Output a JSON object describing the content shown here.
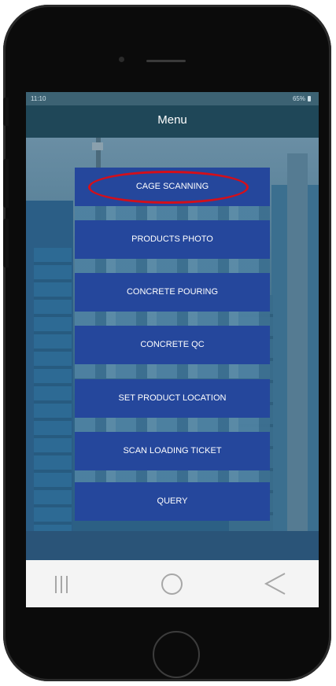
{
  "status_bar": {
    "time": "11:10",
    "battery": "65%"
  },
  "app_bar": {
    "title": "Menu"
  },
  "menu": {
    "items": [
      {
        "label": "CAGE SCANNING"
      },
      {
        "label": "PRODUCTS PHOTO"
      },
      {
        "label": "CONCRETE POURING"
      },
      {
        "label": "CONCRETE QC"
      },
      {
        "label": "SET PRODUCT LOCATION"
      },
      {
        "label": "SCAN LOADING TICKET"
      },
      {
        "label": "QUERY"
      }
    ],
    "highlighted_item": "CAGE SCANNING"
  },
  "nav_bar": {
    "icons": [
      "recent-apps-icon",
      "home-icon",
      "back-icon"
    ]
  },
  "colors": {
    "button": "#25479c",
    "app_bar": "#1f4758",
    "highlight": "#d40f1a",
    "nav_bar": "#f4f4f4"
  }
}
